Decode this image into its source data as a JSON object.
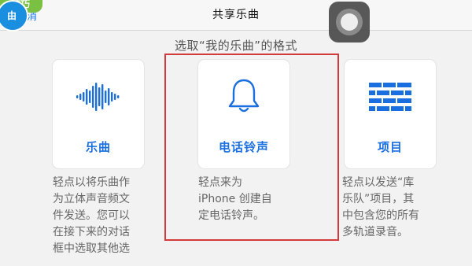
{
  "header": {
    "title": "共享乐曲",
    "cancel_label": "消",
    "badge_label": "技巧",
    "circle_label": "由"
  },
  "subtitle": "选取“我的乐曲”的格式",
  "options": [
    {
      "label": "乐曲",
      "icon": "waveform-icon",
      "description": "轻点以将乐曲作\n为立体声音频文\n件发送。您可以\n在接下来的对话\n框中选取其他选"
    },
    {
      "label": "电话铃声",
      "icon": "bell-icon",
      "description": "轻点来为\niPhone 创建自\n定电话铃声。"
    },
    {
      "label": "项目",
      "icon": "bricks-icon",
      "description": "轻点以发送“库\n乐队”项目，其\n中包含您的所有\n多轨道录音。"
    }
  ],
  "colors": {
    "accent": "#1a6fe0",
    "highlight": "#d43a3a"
  }
}
